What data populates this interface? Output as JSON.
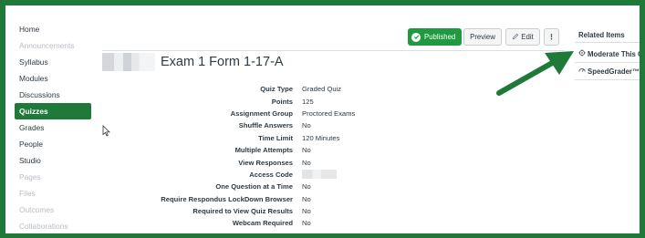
{
  "nav": {
    "items": [
      {
        "label": "Home",
        "state": "normal"
      },
      {
        "label": "Announcements",
        "state": "disabled"
      },
      {
        "label": "Syllabus",
        "state": "normal"
      },
      {
        "label": "Modules",
        "state": "normal"
      },
      {
        "label": "Discussions",
        "state": "normal"
      },
      {
        "label": "Quizzes",
        "state": "active"
      },
      {
        "label": "Grades",
        "state": "normal"
      },
      {
        "label": "People",
        "state": "normal"
      },
      {
        "label": "Studio",
        "state": "normal"
      },
      {
        "label": "Pages",
        "state": "disabled"
      },
      {
        "label": "Files",
        "state": "disabled"
      },
      {
        "label": "Outcomes",
        "state": "disabled"
      },
      {
        "label": "Collaborations",
        "state": "disabled"
      }
    ]
  },
  "header": {
    "published_label": "Published",
    "preview_label": "Preview",
    "edit_label": "Edit",
    "more_label": "⋮"
  },
  "quiz": {
    "title": "Exam 1 Form 1-17-A",
    "details": [
      {
        "label": "Quiz Type",
        "value": "Graded Quiz"
      },
      {
        "label": "Points",
        "value": "125"
      },
      {
        "label": "Assignment Group",
        "value": "Proctored Exams"
      },
      {
        "label": "Shuffle Answers",
        "value": "No"
      },
      {
        "label": "Time Limit",
        "value": "120 Minutes"
      },
      {
        "label": "Multiple Attempts",
        "value": "No"
      },
      {
        "label": "View Responses",
        "value": "No"
      },
      {
        "label": "Access Code",
        "value": ""
      },
      {
        "label": "One Question at a Time",
        "value": "No"
      },
      {
        "label": "Require Respondus LockDown Browser",
        "value": "No"
      },
      {
        "label": "Required to View Quiz Results",
        "value": "No"
      },
      {
        "label": "Webcam Required",
        "value": "No"
      }
    ]
  },
  "related": {
    "title": "Related Items",
    "items": [
      {
        "label": "Moderate This Quiz",
        "icon": "gear-icon"
      },
      {
        "label": "SpeedGrader™",
        "icon": "speedgrader-icon"
      }
    ]
  },
  "colors": {
    "frame": "#1f7a3a",
    "active_nav": "#1f7a3a",
    "published": "#1f9a3e",
    "arrow": "#1f7a3a",
    "text": "#2d3b45",
    "disabled": "#b8bec4"
  }
}
